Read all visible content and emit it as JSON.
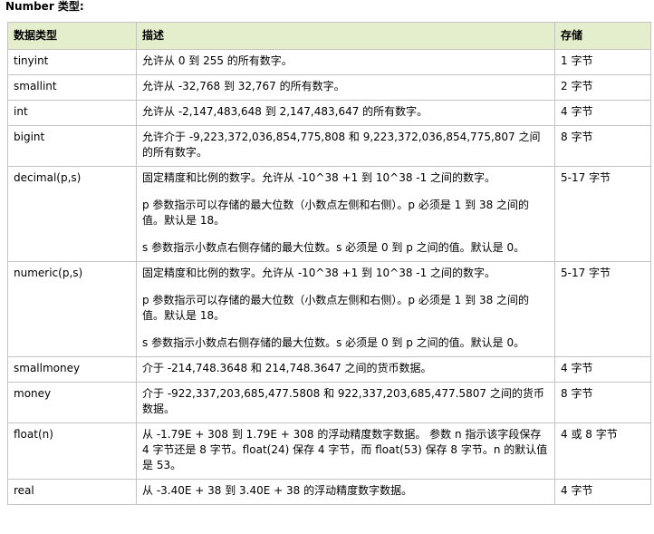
{
  "heading": "Number 类型:",
  "table": {
    "headers": [
      "数据类型",
      "描述",
      "存储"
    ],
    "rows": [
      {
        "type": "tinyint",
        "desc": [
          "允许从 0 到 255 的所有数字。"
        ],
        "storage": "1 字节"
      },
      {
        "type": "smallint",
        "desc": [
          "允许从 -32,768 到 32,767 的所有数字。"
        ],
        "storage": "2 字节"
      },
      {
        "type": "int",
        "desc": [
          "允许从 -2,147,483,648 到 2,147,483,647 的所有数字。"
        ],
        "storage": "4 字节"
      },
      {
        "type": "bigint",
        "desc": [
          "允许介于 -9,223,372,036,854,775,808 和 9,223,372,036,854,775,807 之间的所有数字。"
        ],
        "storage": "8 字节"
      },
      {
        "type": "decimal(p,s)",
        "desc": [
          "固定精度和比例的数字。允许从 -10^38 +1 到 10^38 -1 之间的数字。",
          "p 参数指示可以存储的最大位数（小数点左侧和右侧）。p 必须是 1 到 38 之间的值。默认是 18。",
          "s 参数指示小数点右侧存储的最大位数。s 必须是 0 到 p 之间的值。默认是 0。"
        ],
        "storage": "5-17 字节"
      },
      {
        "type": "numeric(p,s)",
        "desc": [
          "固定精度和比例的数字。允许从 -10^38 +1 到 10^38 -1 之间的数字。",
          "p 参数指示可以存储的最大位数（小数点左侧和右侧）。p 必须是 1 到 38 之间的值。默认是 18。",
          "s 参数指示小数点右侧存储的最大位数。s 必须是 0 到 p 之间的值。默认是 0。"
        ],
        "storage": "5-17 字节"
      },
      {
        "type": "smallmoney",
        "desc": [
          "介于 -214,748.3648 和 214,748.3647 之间的货币数据。"
        ],
        "storage": "4 字节"
      },
      {
        "type": "money",
        "desc": [
          "介于 -922,337,203,685,477.5808 和 922,337,203,685,477.5807 之间的货币数据。"
        ],
        "storage": "8 字节"
      },
      {
        "type": "float(n)",
        "desc": [
          "从 -1.79E + 308 到 1.79E + 308 的浮动精度数字数据。 参数 n 指示该字段保存 4 字节还是 8 字节。float(24) 保存 4 字节，而 float(53) 保存 8 字节。n 的默认值是 53。"
        ],
        "storage": "4 或 8 字节"
      },
      {
        "type": "real",
        "desc": [
          "从 -3.40E + 38 到 3.40E + 38 的浮动精度数字数据。"
        ],
        "storage": "4 字节"
      }
    ]
  },
  "colors": {
    "header_bg": "#e5eecc",
    "border": "#c3c3c3"
  }
}
